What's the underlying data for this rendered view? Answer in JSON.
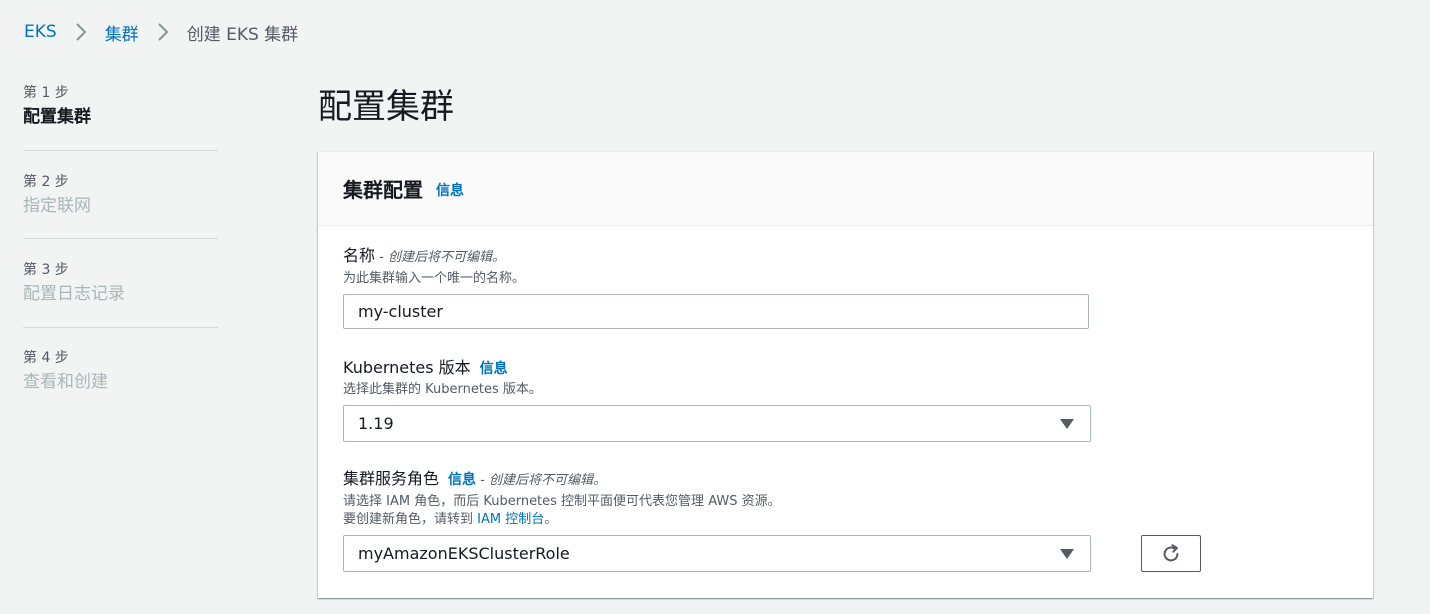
{
  "breadcrumb": {
    "items": [
      "EKS",
      "集群"
    ],
    "current": "创建 EKS 集群"
  },
  "steps": [
    {
      "num": "第 1 步",
      "name": "配置集群",
      "active": true
    },
    {
      "num": "第 2 步",
      "name": "指定联网",
      "active": false
    },
    {
      "num": "第 3 步",
      "name": "配置日志记录",
      "active": false
    },
    {
      "num": "第 4 步",
      "name": "查看和创建",
      "active": false
    }
  ],
  "page_title": "配置集群",
  "panel": {
    "title": "集群配置",
    "info": "信息"
  },
  "name_field": {
    "label": "名称",
    "separator": " - ",
    "constraint": "创建后将不可编辑。",
    "description": "为此集群输入一个唯一的名称。",
    "value": "my-cluster"
  },
  "version_field": {
    "label": "Kubernetes 版本",
    "info": "信息",
    "description": "选择此集群的 Kubernetes 版本。",
    "selected": "1.19"
  },
  "role_field": {
    "label": "集群服务角色",
    "info": "信息",
    "separator": " - ",
    "constraint": "创建后将不可编辑。",
    "description_line1": "请选择 IAM 角色，而后 Kubernetes 控制平面便可代表您管理 AWS 资源。",
    "description_line2_prefix": "要创建新角色，请转到 ",
    "iam_console_link": "IAM 控制台",
    "description_line2_suffix": "。",
    "selected": "myAmazonEKSClusterRole"
  },
  "colors": {
    "link": "#0073bb",
    "background": "#f2f3f3",
    "text": "#16191f",
    "muted": "#545b64",
    "disabled": "#aab7b8"
  },
  "icons": {
    "breadcrumb_separator": "chevron-right-icon",
    "select_caret": "caret-down-icon",
    "refresh": "refresh-icon"
  }
}
